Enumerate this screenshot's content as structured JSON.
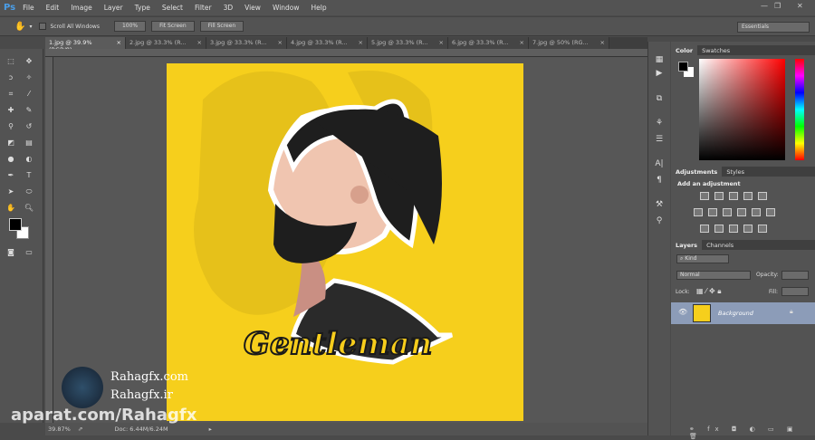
{
  "app": {
    "logo": "Ps",
    "menu": [
      "File",
      "Edit",
      "Image",
      "Layer",
      "Type",
      "Select",
      "Filter",
      "3D",
      "View",
      "Window",
      "Help"
    ]
  },
  "options": {
    "scroll_all": "Scroll All Windows",
    "zoom100": "100%",
    "fit": "Fit Screen",
    "fill": "Fill Screen",
    "workspace": "Essentials"
  },
  "tabs": [
    {
      "label": "1.jpg @ 39.9% (RGB/8)",
      "active": true
    },
    {
      "label": "2.jpg @ 33.3% (R..."
    },
    {
      "label": "3.jpg @ 33.3% (R..."
    },
    {
      "label": "4.jpg @ 33.3% (R..."
    },
    {
      "label": "5.jpg @ 33.3% (R..."
    },
    {
      "label": "6.jpg @ 33.3% (R..."
    },
    {
      "label": "7.jpg @ 50% (RG..."
    }
  ],
  "canvas": {
    "text": "Gentleman",
    "bg": "#f6cf1c"
  },
  "status": {
    "zoom": "39.87%",
    "doc": "Doc: 6.44M/6.24M"
  },
  "panels": {
    "color_tabs": [
      "Color",
      "Swatches"
    ],
    "adj_tabs": [
      "Adjustments",
      "Styles"
    ],
    "adj_title": "Add an adjustment",
    "layer_tabs": [
      "Layers",
      "Channels"
    ],
    "kind": "Kind",
    "blend": "Normal",
    "opacity_label": "Opacity:",
    "lock_label": "Lock:",
    "fill_label": "Fill:",
    "layer_name": "Background"
  },
  "watermark": {
    "site1": "Rahagfx.com",
    "site2": "Rahagfx.ir",
    "aparat": "aparat.com/Rahagfx"
  }
}
